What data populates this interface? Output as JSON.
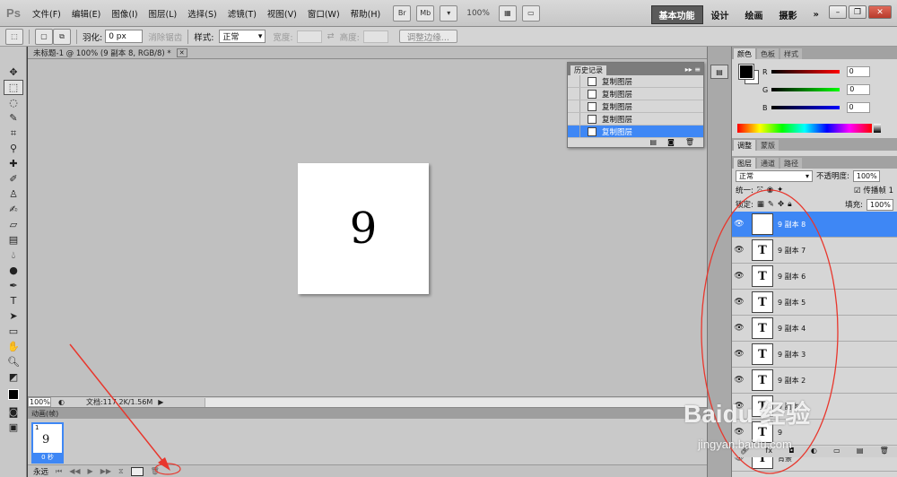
{
  "app": {
    "logo": "Ps"
  },
  "menu": [
    "文件(F)",
    "编辑(E)",
    "图像(I)",
    "图层(L)",
    "选择(S)",
    "滤镜(T)",
    "视图(V)",
    "窗口(W)",
    "帮助(H)"
  ],
  "menu_tools": {
    "br": "Br",
    "mb": "Mb",
    "zoom": "100%"
  },
  "workspace": {
    "active": "基本功能",
    "items": [
      "设计",
      "绘画",
      "摄影"
    ],
    "more": "»"
  },
  "options": {
    "feather_label": "羽化:",
    "feather_value": "0 px",
    "antialias": "消除锯齿",
    "style_label": "样式:",
    "style_value": "正常",
    "width_label": "宽度:",
    "height_label": "高度:",
    "refine_edge": "调整边缘..."
  },
  "document": {
    "tab_title": "未标题-1 @ 100% (9 副本 8, RGB/8) *",
    "canvas_text": "9",
    "zoom": "100%",
    "doc_info": "文档:117.2K/1.56M"
  },
  "history": {
    "tab": "历史记录",
    "rows": [
      "复制图层",
      "复制图层",
      "复制图层",
      "复制图层",
      "复制图层"
    ],
    "selected_index": 4
  },
  "animation": {
    "tab": "动画(帧)",
    "frame_number": "1",
    "frame_digit": "9",
    "frame_time": "0 秒",
    "loop": "永远"
  },
  "color_panel": {
    "tabs": [
      "颜色",
      "色板",
      "样式"
    ],
    "r_label": "R",
    "g_label": "G",
    "b_label": "B",
    "r": "0",
    "g": "0",
    "b": "0"
  },
  "adjust_tabs": [
    "调整",
    "蒙版"
  ],
  "layers_panel": {
    "tabs": [
      "图层",
      "通道",
      "路径"
    ],
    "blend_mode": "正常",
    "opacity_label": "不透明度:",
    "opacity": "100%",
    "unify_label": "统一:",
    "propagate_label": "传播帧 1",
    "lock_label": "锁定:",
    "fill_label": "填充:",
    "fill": "100%",
    "layers": [
      {
        "name": "9 副本 8",
        "selected": true
      },
      {
        "name": "9 副本 7",
        "selected": false
      },
      {
        "name": "9 副本 6",
        "selected": false
      },
      {
        "name": "9 副本 5",
        "selected": false
      },
      {
        "name": "9 副本 4",
        "selected": false
      },
      {
        "name": "9 副本 3",
        "selected": false
      },
      {
        "name": "9 副本 2",
        "selected": false
      },
      {
        "name": "9 副本",
        "selected": false
      },
      {
        "name": "9",
        "selected": false
      },
      {
        "name": "背景",
        "selected": false
      }
    ]
  },
  "watermark": {
    "brand": "Baidu 经验",
    "url": "jingyan.baidu.com"
  },
  "colors": {
    "selection_blue": "#3e87f5",
    "annotation_red": "#e8362c"
  }
}
